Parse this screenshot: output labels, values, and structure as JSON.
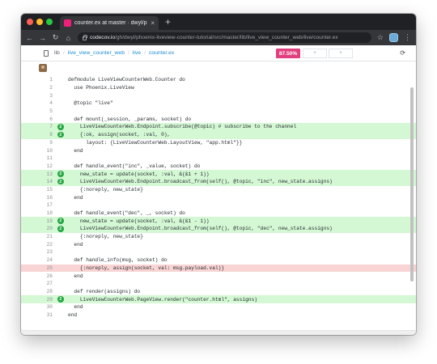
{
  "browser": {
    "tab_title": "counter.ex at master · dwyl/phoe",
    "tab_close": "×",
    "new_tab": "+",
    "url_host": "codecov.io",
    "url_path": "/gh/dwyl/phoenix-liveview-counter-tutorial/src/master/lib/live_view_counter_web/live/counter.ex",
    "icons": {
      "back": "←",
      "forward": "→",
      "reload": "↻",
      "home": "⌂",
      "star": "☆",
      "menu": "⋮"
    },
    "colors": {
      "tab_favicon": "#f01f7a",
      "window_frame": "#202124"
    }
  },
  "filebar": {
    "breadcrumbs": [
      "lib",
      "live_view_counter_web",
      "live",
      "counter.ex"
    ],
    "separator": "/",
    "coverage": "87.50%",
    "toggle_1": "+",
    "toggle_2": "+",
    "refresh_icon": "⟳"
  },
  "code": {
    "lines": [
      {
        "n": "1",
        "text": "defmodule LiveViewCounterWeb.Counter do",
        "status": "",
        "hits": ""
      },
      {
        "n": "2",
        "text": "  use Phoenix.LiveView",
        "status": "",
        "hits": ""
      },
      {
        "n": "3",
        "text": "",
        "status": "",
        "hits": ""
      },
      {
        "n": "4",
        "text": "  @topic \"live\"",
        "status": "",
        "hits": ""
      },
      {
        "n": "5",
        "text": "",
        "status": "",
        "hits": ""
      },
      {
        "n": "6",
        "text": "  def mount(_session, _params, socket) do",
        "status": "",
        "hits": ""
      },
      {
        "n": "7",
        "text": "    LiveViewCounterWeb.Endpoint.subscribe(@topic) # subscribe to the channel",
        "status": "hit",
        "hits": "2"
      },
      {
        "n": "8",
        "text": "    {:ok, assign(socket, :val, 0),",
        "status": "hit",
        "hits": "2"
      },
      {
        "n": "9",
        "text": "      layout: {LiveViewCounterWeb.LayoutView, \"app.html\"}}",
        "status": "",
        "hits": ""
      },
      {
        "n": "10",
        "text": "  end",
        "status": "",
        "hits": ""
      },
      {
        "n": "11",
        "text": "",
        "status": "",
        "hits": ""
      },
      {
        "n": "12",
        "text": "  def handle_event(\"inc\", _value, socket) do",
        "status": "",
        "hits": ""
      },
      {
        "n": "13",
        "text": "    new_state = update(socket, :val, &(&1 + 1))",
        "status": "hit",
        "hits": "2"
      },
      {
        "n": "14",
        "text": "    LiveViewCounterWeb.Endpoint.broadcast_from(self(), @topic, \"inc\", new_state.assigns)",
        "status": "hit",
        "hits": "2"
      },
      {
        "n": "15",
        "text": "    {:noreply, new_state}",
        "status": "",
        "hits": ""
      },
      {
        "n": "16",
        "text": "  end",
        "status": "",
        "hits": ""
      },
      {
        "n": "17",
        "text": "",
        "status": "",
        "hits": ""
      },
      {
        "n": "18",
        "text": "  def handle_event(\"dec\", _, socket) do",
        "status": "",
        "hits": ""
      },
      {
        "n": "19",
        "text": "    new_state = update(socket, :val, &(&1 - 1))",
        "status": "hit",
        "hits": "2"
      },
      {
        "n": "20",
        "text": "    LiveViewCounterWeb.Endpoint.broadcast_from(self(), @topic, \"dec\", new_state.assigns)",
        "status": "hit",
        "hits": "2"
      },
      {
        "n": "21",
        "text": "    {:noreply, new_state}",
        "status": "",
        "hits": ""
      },
      {
        "n": "22",
        "text": "  end",
        "status": "",
        "hits": ""
      },
      {
        "n": "23",
        "text": "",
        "status": "",
        "hits": ""
      },
      {
        "n": "24",
        "text": "  def handle_info(msg, socket) do",
        "status": "",
        "hits": ""
      },
      {
        "n": "25",
        "text": "    {:noreply, assign(socket, val: msg.payload.val)}",
        "status": "miss",
        "hits": ""
      },
      {
        "n": "26",
        "text": "  end",
        "status": "",
        "hits": ""
      },
      {
        "n": "27",
        "text": "",
        "status": "",
        "hits": ""
      },
      {
        "n": "28",
        "text": "  def render(assigns) do",
        "status": "",
        "hits": ""
      },
      {
        "n": "29",
        "text": "    LiveViewCounterWeb.PageView.render(\"counter.html\", assigns)",
        "status": "hit",
        "hits": "2"
      },
      {
        "n": "30",
        "text": "  end",
        "status": "",
        "hits": ""
      },
      {
        "n": "31",
        "text": "end",
        "status": "",
        "hits": ""
      }
    ],
    "colors": {
      "hit_bg": "#d4f8d4",
      "miss_bg": "#f9d4d4",
      "badge": "#28a745",
      "coverage_badge": "#e0407f"
    }
  }
}
